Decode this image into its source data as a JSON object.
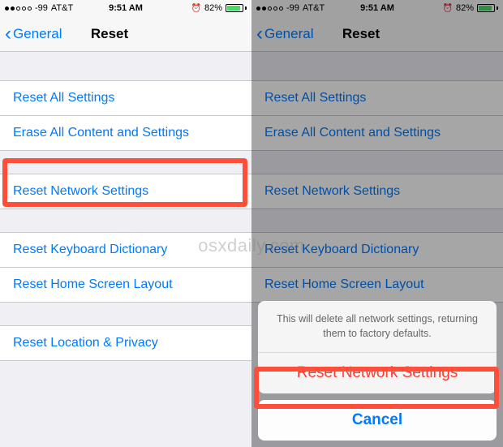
{
  "status": {
    "signal": "-99",
    "carrier": "AT&T",
    "time": "9:51 AM",
    "battery_pct": "82%"
  },
  "nav": {
    "back": "General",
    "title": "Reset"
  },
  "rows": {
    "reset_all": "Reset All Settings",
    "erase_all": "Erase All Content and Settings",
    "reset_network": "Reset Network Settings",
    "reset_keyboard": "Reset Keyboard Dictionary",
    "reset_home": "Reset Home Screen Layout",
    "reset_location": "Reset Location & Privacy"
  },
  "sheet": {
    "message": "This will delete all network settings, returning them to factory defaults.",
    "action": "Reset Network Settings",
    "cancel": "Cancel"
  },
  "watermark": "osxdaily.com"
}
